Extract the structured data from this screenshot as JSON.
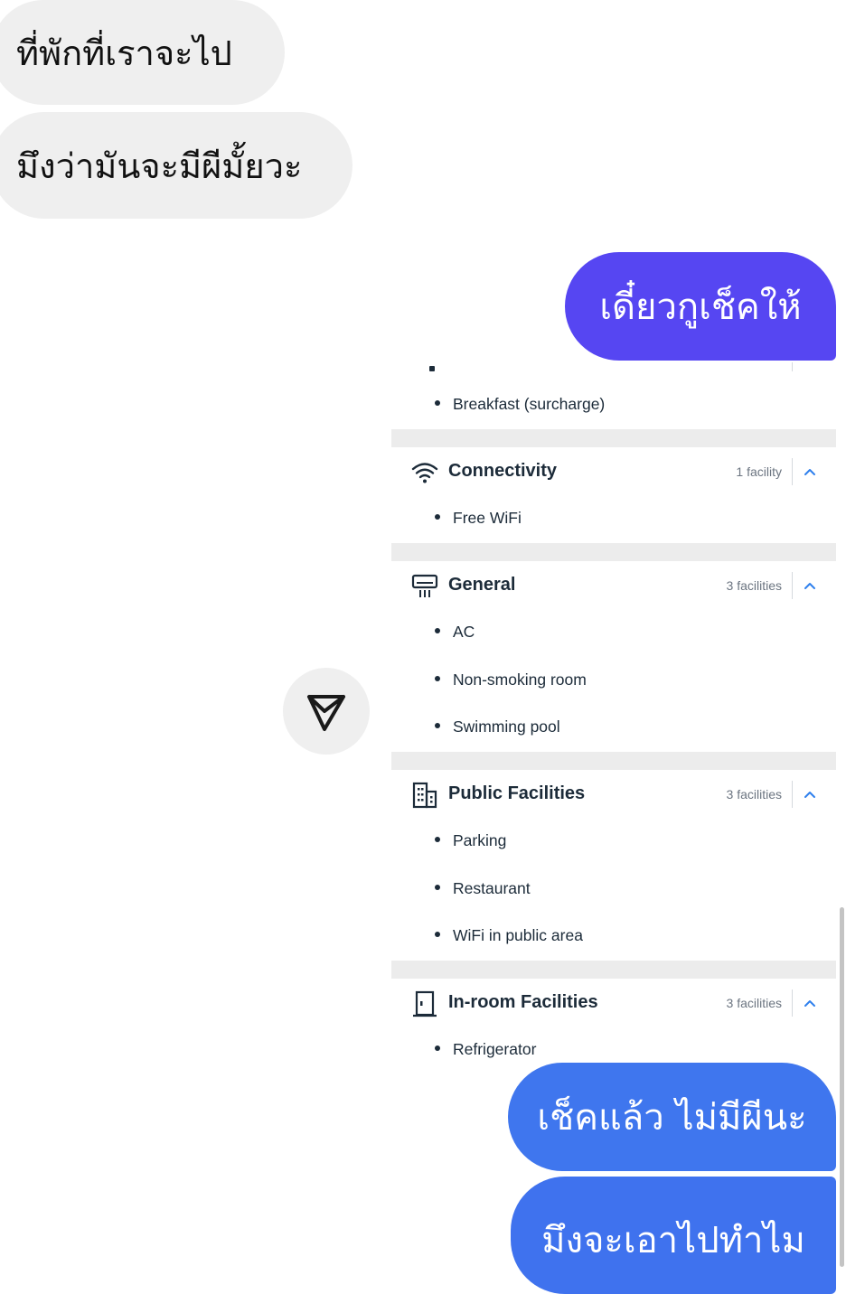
{
  "messages": {
    "incoming": [
      {
        "text": "ที่พักที่เราจะไป"
      },
      {
        "text": "มึงว่ามันจะมีผีมั้ยวะ"
      }
    ],
    "outgoing_top": {
      "text": "เดี๋ยวกูเช็คให้"
    },
    "outgoing_bottom": [
      {
        "text": "เช็คแล้ว ไม่มีผีนะ"
      },
      {
        "text": "มึงจะเอาไปทำไม"
      }
    ]
  },
  "share_button": {
    "icon": "send-icon"
  },
  "facilities": {
    "partial_item": "Breakfast (surcharge)",
    "sections": [
      {
        "title": "Connectivity",
        "count": "1 facility",
        "icon": "wifi-icon",
        "items": [
          "Free WiFi"
        ]
      },
      {
        "title": "General",
        "count": "3 facilities",
        "icon": "air-conditioner-icon",
        "items": [
          "AC",
          "Non-smoking room",
          "Swimming pool"
        ]
      },
      {
        "title": "Public Facilities",
        "count": "3 facilities",
        "icon": "building-icon",
        "items": [
          "Parking",
          "Restaurant",
          "WiFi in public area"
        ]
      },
      {
        "title": "In-room Facilities",
        "count": "3 facilities",
        "icon": "door-icon",
        "items": [
          "Refrigerator"
        ]
      }
    ]
  },
  "colors": {
    "outgoing_purple": "#5646f2",
    "outgoing_blue": "#3f76ee",
    "incoming_gray": "#efefef",
    "chevron_blue": "#2f80ed"
  }
}
